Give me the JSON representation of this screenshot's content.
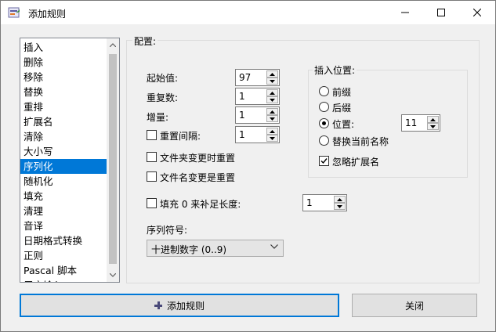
{
  "window": {
    "title": "添加规则"
  },
  "rule_list": {
    "items": [
      "插入",
      "删除",
      "移除",
      "替换",
      "重排",
      "扩展名",
      "清除",
      "大小写",
      "序列化",
      "随机化",
      "填充",
      "清理",
      "音译",
      "日期格式转换",
      "正则",
      "Pascal 脚本",
      "用户输入"
    ],
    "selected": "序列化"
  },
  "config": {
    "group_label": "配置:",
    "start_value": {
      "label": "起始值:",
      "value": "97"
    },
    "repeat": {
      "label": "重复数:",
      "value": "1"
    },
    "step": {
      "label": "增量:",
      "value": "1"
    },
    "reset_interval": {
      "label": "重置间隔:",
      "value": "1",
      "checked": false
    },
    "reset_on_folder_change": {
      "label": "文件夹变更时重置",
      "checked": false
    },
    "reset_on_filename_change": {
      "label": "文件名变更是重置",
      "checked": false
    },
    "pad": {
      "label": "填充 0 来补足长度:",
      "value": "1",
      "checked": false
    },
    "sequence_symbol": {
      "label": "序列符号:",
      "value": "十进制数字 (0..9)"
    },
    "insert_position": {
      "label": "插入位置:",
      "prefix": "前缀",
      "suffix": "后缀",
      "position": "位置:",
      "position_value": "11",
      "replace_name": "替换当前名称",
      "selected": "position",
      "ignore_extension": {
        "label": "忽略扩展名",
        "checked": true
      }
    }
  },
  "buttons": {
    "add_rule": "添加规则",
    "close": "关闭"
  }
}
